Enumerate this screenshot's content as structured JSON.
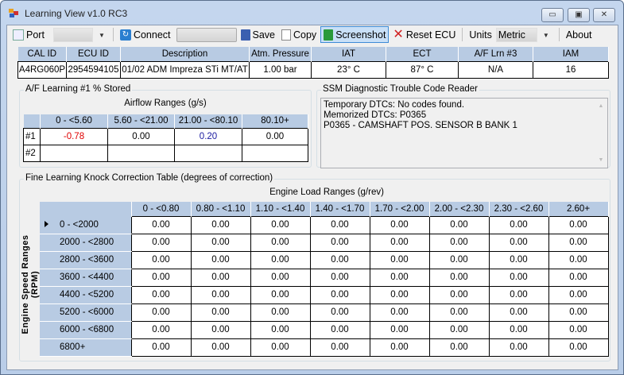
{
  "window": {
    "title": "Learning View v1.0 RC3",
    "minimize": "▭",
    "maximize": "▣",
    "close": "✕"
  },
  "toolbar": {
    "port_label": "Port",
    "port_value": "",
    "connect_label": "Connect",
    "connect_value": "",
    "save_label": "Save",
    "copy_label": "Copy",
    "screenshot_label": "Screenshot",
    "reset_label": "Reset ECU",
    "units_label": "Units",
    "units_value": "Metric",
    "about_label": "About"
  },
  "info": {
    "headers": [
      "CAL ID",
      "ECU ID",
      "Description",
      "Atm. Pressure",
      "IAT",
      "ECT",
      "A/F Lrn #3",
      "IAM"
    ],
    "values": [
      "A4RG060P",
      "2954594105",
      "01/02 ADM Impreza STi MT/AT",
      "1.00 bar",
      "23° C",
      "87° C",
      "N/A",
      "16"
    ]
  },
  "af": {
    "title": "A/F Learning #1 % Stored",
    "subtitle": "Airflow Ranges (g/s)",
    "columns": [
      "0 - <5.60",
      "5.60 - <21.00",
      "21.00 - <80.10",
      "80.10+"
    ],
    "rows": [
      {
        "label": "#1",
        "values": [
          "-0.78",
          "0.00",
          "0.20",
          "0.00"
        ],
        "colors": [
          "#e00000",
          "#000000",
          "#1a1aa0",
          "#000000"
        ]
      },
      {
        "label": "#2",
        "values": [
          "",
          "",
          "",
          ""
        ]
      }
    ]
  },
  "dtc": {
    "title": "SSM Diagnostic Trouble Code Reader",
    "lines": [
      "Temporary DTCs: No codes found.",
      "Memorized DTCs: P0365",
      "P0365 - CAMSHAFT POS. SENSOR B BANK 1"
    ]
  },
  "knock": {
    "title": "Fine Learning Knock Correction Table (degrees of correction)",
    "col_title": "Engine Load Ranges (g/rev)",
    "row_title": "Engine Speed Ranges (RPM)",
    "columns": [
      "0 - <0.80",
      "0.80 - <1.10",
      "1.10 - <1.40",
      "1.40 - <1.70",
      "1.70 - <2.00",
      "2.00 - <2.30",
      "2.30 - <2.60",
      "2.60+"
    ],
    "rows": [
      {
        "label": "0 - <2000",
        "values": [
          "0.00",
          "0.00",
          "0.00",
          "0.00",
          "0.00",
          "0.00",
          "0.00",
          "0.00"
        ]
      },
      {
        "label": "2000 - <2800",
        "values": [
          "0.00",
          "0.00",
          "0.00",
          "0.00",
          "0.00",
          "0.00",
          "0.00",
          "0.00"
        ]
      },
      {
        "label": "2800 - <3600",
        "values": [
          "0.00",
          "0.00",
          "0.00",
          "0.00",
          "0.00",
          "0.00",
          "0.00",
          "0.00"
        ]
      },
      {
        "label": "3600 - <4400",
        "values": [
          "0.00",
          "0.00",
          "0.00",
          "0.00",
          "0.00",
          "0.00",
          "0.00",
          "0.00"
        ]
      },
      {
        "label": "4400 - <5200",
        "values": [
          "0.00",
          "0.00",
          "0.00",
          "0.00",
          "0.00",
          "0.00",
          "0.00",
          "0.00"
        ]
      },
      {
        "label": "5200 - <6000",
        "values": [
          "0.00",
          "0.00",
          "0.00",
          "0.00",
          "0.00",
          "0.00",
          "0.00",
          "0.00"
        ]
      },
      {
        "label": "6000 - <6800",
        "values": [
          "0.00",
          "0.00",
          "0.00",
          "0.00",
          "0.00",
          "0.00",
          "0.00",
          "0.00"
        ]
      },
      {
        "label": "6800+",
        "values": [
          "0.00",
          "0.00",
          "0.00",
          "0.00",
          "0.00",
          "0.00",
          "0.00",
          "0.00"
        ]
      }
    ]
  }
}
